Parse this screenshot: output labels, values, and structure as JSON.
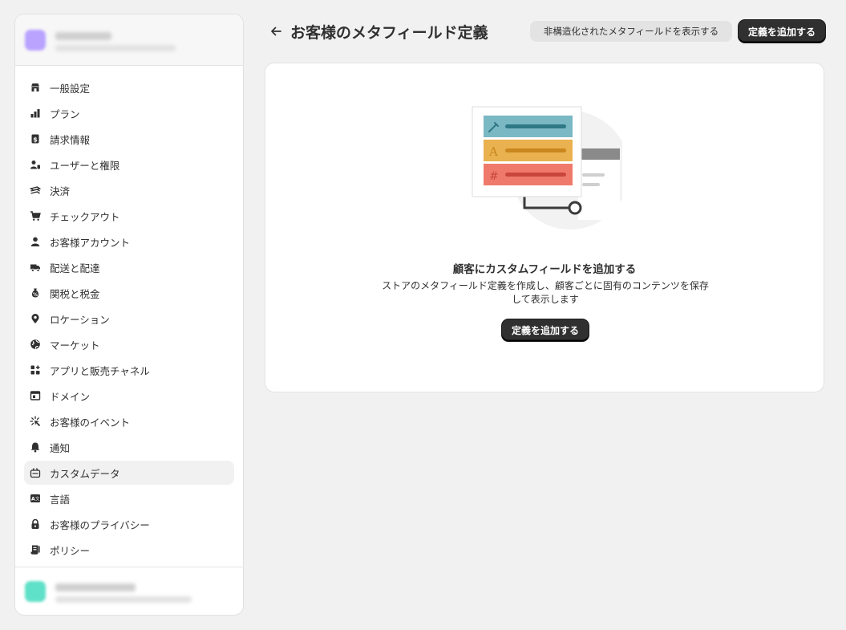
{
  "sidebar": {
    "account": {
      "name": "",
      "sub": "",
      "avatar_color": "#b9a3ff"
    },
    "items": [
      {
        "label": "一般設定",
        "icon": "store-icon"
      },
      {
        "label": "プラン",
        "icon": "plan-icon"
      },
      {
        "label": "請求情報",
        "icon": "billing-icon"
      },
      {
        "label": "ユーザーと権限",
        "icon": "users-icon"
      },
      {
        "label": "決済",
        "icon": "payment-icon"
      },
      {
        "label": "チェックアウト",
        "icon": "cart-icon"
      },
      {
        "label": "お客様アカウント",
        "icon": "person-icon"
      },
      {
        "label": "配送と配達",
        "icon": "truck-icon"
      },
      {
        "label": "関税と税金",
        "icon": "tax-icon"
      },
      {
        "label": "ロケーション",
        "icon": "location-icon"
      },
      {
        "label": "マーケット",
        "icon": "globe-icon"
      },
      {
        "label": "アプリと販売チャネル",
        "icon": "apps-icon"
      },
      {
        "label": "ドメイン",
        "icon": "domain-icon"
      },
      {
        "label": "お客様のイベント",
        "icon": "event-icon"
      },
      {
        "label": "通知",
        "icon": "bell-icon"
      },
      {
        "label": "カスタムデータ",
        "icon": "custom-data-icon",
        "active": true
      },
      {
        "label": "言語",
        "icon": "language-icon"
      },
      {
        "label": "お客様のプライバシー",
        "icon": "lock-icon"
      },
      {
        "label": "ポリシー",
        "icon": "policy-icon"
      }
    ],
    "bottom_account": {
      "name": "",
      "sub": "",
      "avatar_color": "#5fe0c8"
    }
  },
  "header": {
    "title": "お客様のメタフィールド定義",
    "secondary_button": "非構造化されたメタフィールドを表示する",
    "primary_button": "定義を追加する"
  },
  "empty_state": {
    "title": "顧客にカスタムフィールドを追加する",
    "description": "ストアのメタフィールド定義を作成し、顧客ごとに固有のコンテンツを保存して表示します",
    "button": "定義を追加する",
    "illustration": {
      "row_colors": [
        "#7ab8c4",
        "#e9b14f",
        "#ef7a6b"
      ],
      "row_icons": [
        "eyedropper-icon",
        "text-icon",
        "hash-icon"
      ]
    }
  }
}
